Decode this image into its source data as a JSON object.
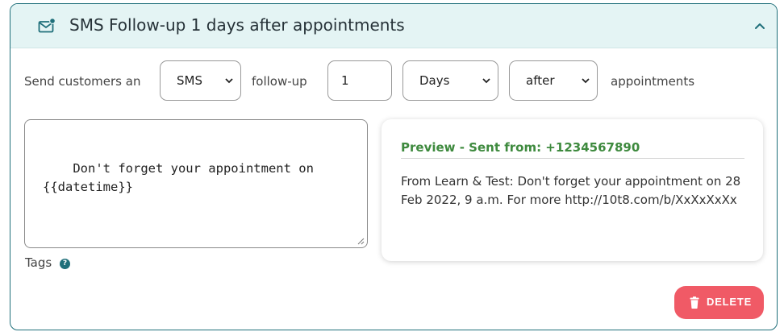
{
  "header": {
    "title": "SMS Follow-up 1 days after appointments",
    "icon": "mail-notification-icon",
    "collapse_icon": "chevron-up-icon"
  },
  "config": {
    "prefix_label": "Send customers an",
    "channel": {
      "value": "SMS",
      "options": [
        "SMS"
      ]
    },
    "middle_label": "follow-up",
    "amount_value": "1",
    "unit": {
      "value": "Days",
      "options": [
        "Days"
      ]
    },
    "timing": {
      "value": "after",
      "options": [
        "after"
      ]
    },
    "suffix_label": "appointments"
  },
  "message": {
    "text": "Don't forget your appointment on\n{{datetime}}"
  },
  "tags": {
    "label": "Tags",
    "help_icon": "help-icon"
  },
  "preview": {
    "heading": "Preview - Sent from: +1234567890",
    "body": "From Learn & Test: Don't forget your appointment on 28 Feb 2022, 9 a.m. For more http://10t8.com/b/XxXxXxXx"
  },
  "actions": {
    "delete_label": "DELETE",
    "delete_icon": "trash-icon"
  },
  "colors": {
    "header_bg": "#e4f4f4",
    "accent": "#1f6f7a",
    "preview_heading": "#3e8a3e",
    "delete_bg": "#f05a66"
  }
}
